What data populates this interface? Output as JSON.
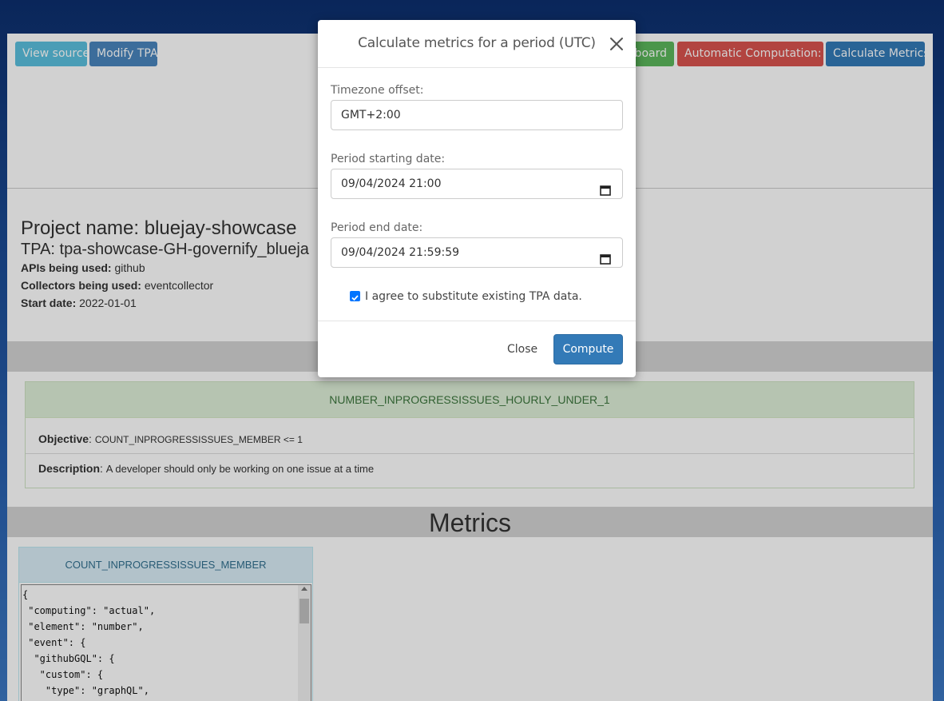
{
  "toolbar": {
    "view_source": "View source",
    "modify_tpa": "Modify TPA",
    "dashboard": "Dashboard",
    "dashboard_visible": "nboard",
    "automatic_computation": "Automatic Computation: No",
    "calculate_metrics": "Calculate Metrics"
  },
  "project": {
    "name": "Project name: bluejay-showcase",
    "tpa": "TPA: tpa-showcase-GH-governify_blueja",
    "apis_label": "APIs being used:",
    "apis_value": "github",
    "collectors_label": "Collectors being used:",
    "collectors_value": "eventcollector",
    "start_label": "Start date:",
    "start_value": "2022-01-01"
  },
  "guarantee": {
    "name": "NUMBER_INPROGRESSISSUES_HOURLY_UNDER_1",
    "objective_label": "Objective",
    "objective_value": "COUNT_INPROGRESSISSUES_MEMBER <= 1",
    "description_label": "Description",
    "description_value": "A developer should only be working on one issue at a time"
  },
  "metrics": {
    "title": "Metrics",
    "card_title": "COUNT_INPROGRESSISSUES_MEMBER",
    "code": "{\n \"computing\": \"actual\",\n \"element\": \"number\",\n \"event\": {\n  \"githubGQL\": {\n   \"custom\": {\n    \"type\": \"graphQL\",\n    \"title\": \"Get issues in progress\","
  },
  "modal": {
    "title": "Calculate metrics for a period (UTC)",
    "timezone_label": "Timezone offset:",
    "timezone_value": "GMT+2:00",
    "start_label": "Period starting date:",
    "start_value": "09/04/2024 21:00",
    "end_label": "Period end date:",
    "end_value": "09/04/2024 21:59:59",
    "agree_text": "I agree to substitute existing TPA data.",
    "agree_checked": true,
    "close_label": "Close",
    "compute_label": "Compute"
  },
  "colors": {
    "info": "#5bc0de",
    "primary": "#337ab7",
    "success": "#5cb85c",
    "danger": "#d9534f"
  }
}
